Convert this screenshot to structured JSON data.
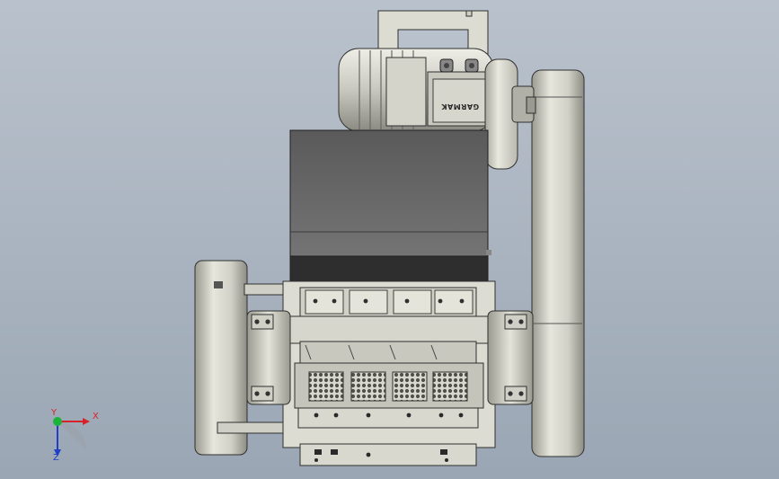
{
  "motor": {
    "brand_label": "GARMAK"
  },
  "triad": {
    "x_label": "X",
    "y_label": "Y",
    "z_label": "Z",
    "x_color": "#d8222a",
    "y_color": "#1bb43a",
    "z_color": "#1f3fc8"
  },
  "colors": {
    "background_top": "#b9c2cc",
    "background_bottom": "#9aa6b4",
    "hopper": "#686868",
    "body_light": "#dcdcd2",
    "edge": "#303030"
  }
}
